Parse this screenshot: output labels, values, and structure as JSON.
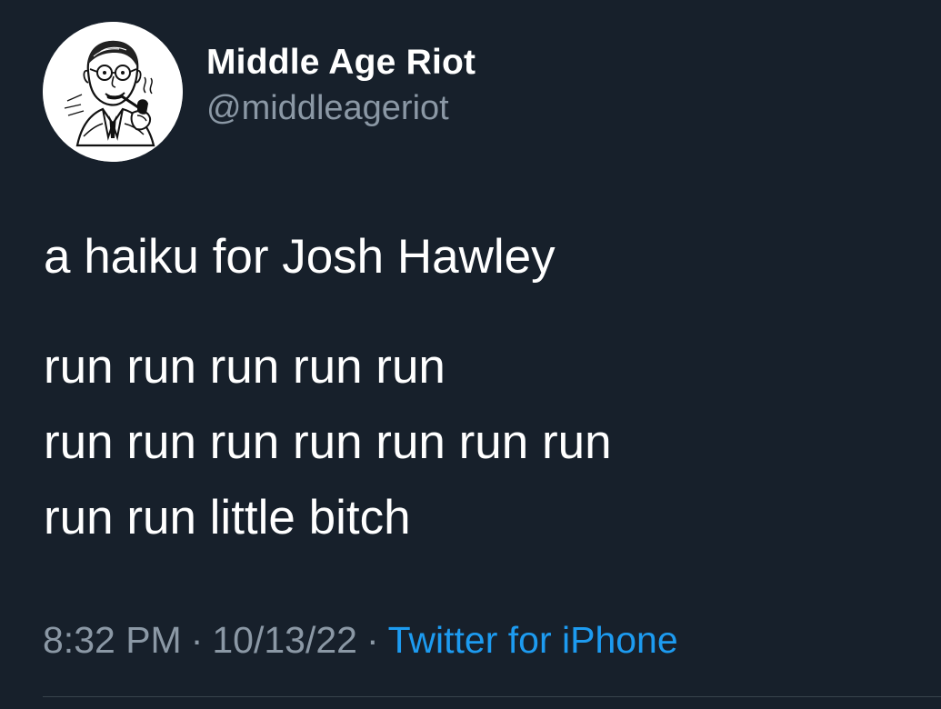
{
  "user": {
    "display_name": "Middle Age Riot",
    "handle": "@middleageriot",
    "avatar_icon": "vintage-man-with-pipe-illustration"
  },
  "tweet": {
    "title": "a haiku for Josh Hawley",
    "lines": [
      "run run run run run",
      "run run run run run run run",
      "run run little bitch"
    ]
  },
  "meta": {
    "time": "8:32 PM",
    "separator": "·",
    "date": "10/13/22",
    "source": "Twitter for iPhone"
  },
  "colors": {
    "background": "#17202b",
    "primary_text": "#ffffff",
    "secondary_text": "#8b98a5",
    "link": "#1d9bf0",
    "divider": "#38444d"
  }
}
